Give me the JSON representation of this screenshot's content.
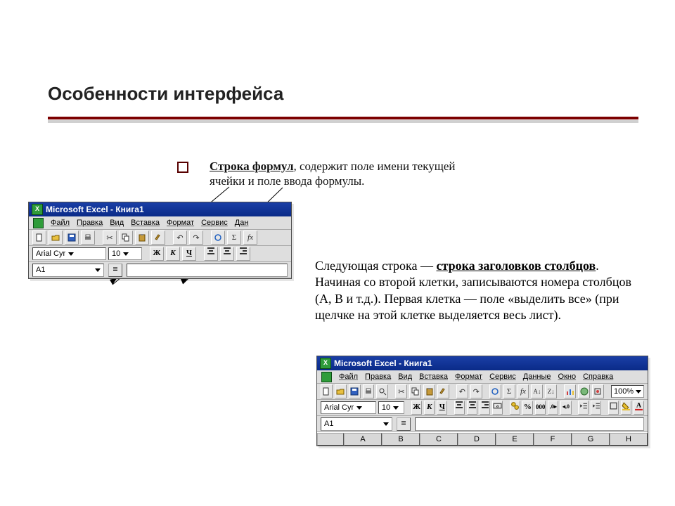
{
  "slide": {
    "title": "Особенности интерфейса"
  },
  "bullet1": {
    "strong": "Строка формул",
    "rest": ", содержит поле имени текущей ячейки и поле ввода формулы."
  },
  "explain2": {
    "pre": "Следующая строка — ",
    "strong": "строка заголовков столбцов",
    "post": ". Начиная со второй клетки, записываются номера столбцов (A, B и т.д.). Первая клетка — поле «выделить все» (при щелчке на этой клетке выделяется весь лист)."
  },
  "xl1": {
    "title": "Microsoft Excel - Книга1",
    "menus": [
      "Файл",
      "Правка",
      "Вид",
      "Вставка",
      "Формат",
      "Сервис",
      "Дан"
    ],
    "font_name": "Arial Cyr",
    "font_size": "10",
    "bold_label": "Ж",
    "italic_label": "К",
    "underline_label": "Ч",
    "namebox": "A1",
    "eq": "="
  },
  "xl2": {
    "title": "Microsoft Excel - Книга1",
    "menus": [
      "Файл",
      "Правка",
      "Вид",
      "Вставка",
      "Формат",
      "Сервис",
      "Данные",
      "Окно",
      "Справка"
    ],
    "zoom": "100%",
    "font_name": "Arial Cyr",
    "font_size": "10",
    "bold_label": "Ж",
    "italic_label": "К",
    "underline_label": "Ч",
    "namebox": "A1",
    "eq": "=",
    "columns": [
      "A",
      "B",
      "C",
      "D",
      "E",
      "F",
      "G",
      "H"
    ]
  }
}
